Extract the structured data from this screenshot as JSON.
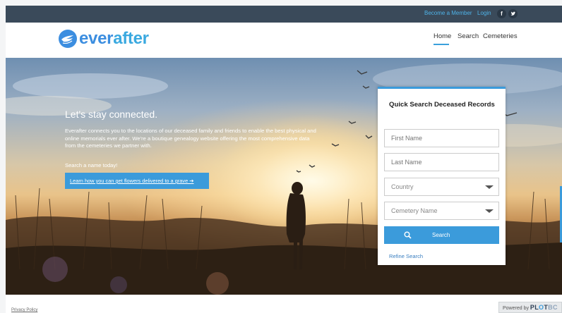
{
  "topbar": {
    "become_member": "Become a Member",
    "login": "Login",
    "facebook_glyph": "f",
    "twitter_glyph": "✳"
  },
  "header": {
    "logo_part1": "ever",
    "logo_part2": "after",
    "nav": [
      "Home",
      "Search",
      "Cemeteries"
    ],
    "active_nav": "Home"
  },
  "hero": {
    "title": "Let's stay connected.",
    "text": "Everafter connects you to the locations of our deceased family and friends to enable the best physical and online memorials ever after. We're a boutique genealogy website offering the most comprehensive data from the cemeteries we partner with.",
    "cta": "Search a name today!",
    "button": "Learn how you can get flowers delivered to a grave ➔"
  },
  "search_panel": {
    "title": "Quick Search Deceased Records",
    "first_name_placeholder": "First Name",
    "last_name_placeholder": "Last Name",
    "country_placeholder": "Country",
    "cemetery_placeholder": "Cemetery Name",
    "search_button": "Search",
    "refine_link": "Refine Search"
  },
  "footer": {
    "privacy": "Privacy Policy",
    "powered_by": "Powered by",
    "powered_brand_a": "PL",
    "powered_brand_o": "O",
    "powered_brand_b": "T",
    "powered_brand_c": "BC"
  },
  "colors": {
    "accent": "#3b9bdb",
    "topbar": "#3a4a5a",
    "link": "#4fb3e8"
  },
  "icons": [
    "facebook-icon",
    "twitter-icon",
    "search-icon",
    "dropdown-caret-icon",
    "logo-bird-icon"
  ]
}
